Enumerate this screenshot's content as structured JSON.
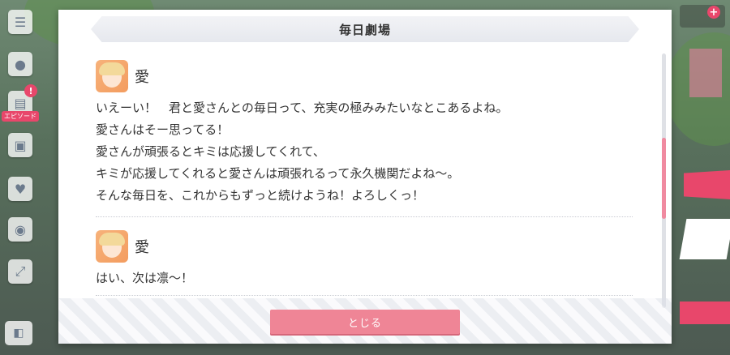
{
  "dialog": {
    "title": "毎日劇場",
    "close_label": "とじる"
  },
  "entries": [
    {
      "speaker": "愛",
      "lines": [
        "いえーい！　君と愛さんとの毎日って、充実の極みみたいなとこあるよね。",
        "愛さんはそー思ってる！",
        "愛さんが頑張るとキミは応援してくれて、",
        "キミが応援してくれると愛さんは頑張れるって永久機関だよね～。",
        "そんな毎日を、これからもずっと続けようね！よろしくっ！"
      ]
    },
    {
      "speaker": "愛",
      "lines": [
        "はい、次は凛～！"
      ]
    }
  ],
  "side_menu": {
    "event_label": "エピソード",
    "badge": "!",
    "icons": [
      "menu-icon",
      "chat-icon",
      "notebook-icon",
      "gift-icon",
      "heart-icon",
      "people-icon",
      "expand-icon"
    ]
  },
  "colors": {
    "accent": "#ef8596",
    "badge": "#e8476b"
  }
}
